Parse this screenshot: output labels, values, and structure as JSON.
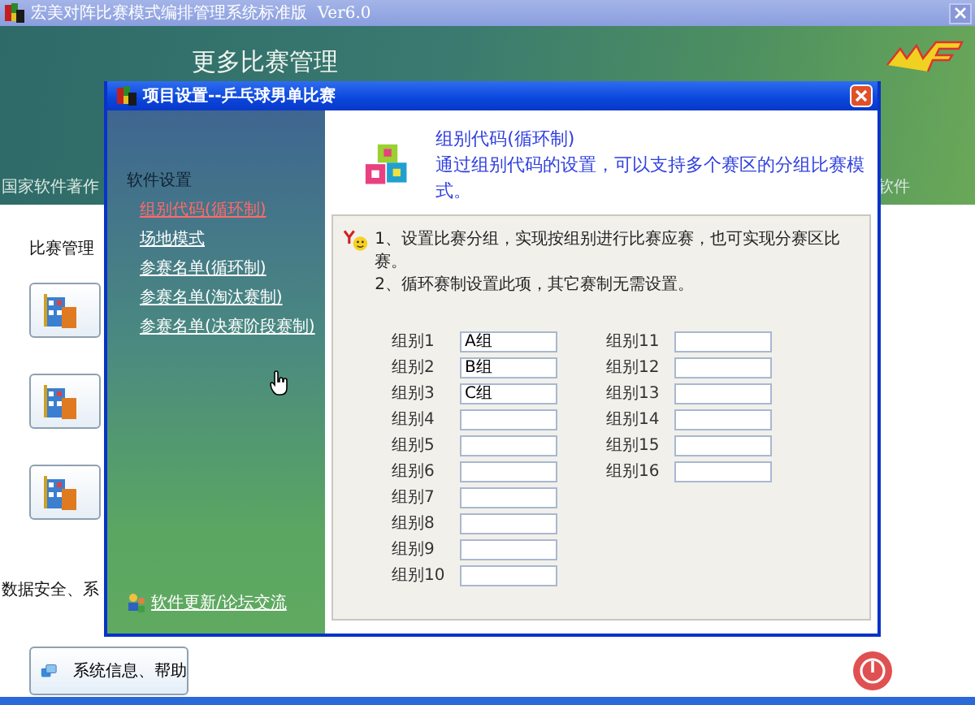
{
  "main_window": {
    "title": "宏美对阵比赛模式编排管理系统标准版  Ver6.0",
    "banner_title": "更多比赛管理",
    "banner_left_text": "国家软件著作",
    "banner_right_text": "软件",
    "section_labels": [
      "比赛管理",
      "数据安全、系"
    ],
    "help_button": {
      "label": "系统信息、帮助"
    }
  },
  "dialog": {
    "title": "项目设置--乒乓球男单比赛",
    "sidebar": {
      "heading": "软件设置",
      "items": [
        {
          "label": "组别代码(循环制)",
          "selected": true
        },
        {
          "label": "场地模式",
          "selected": false
        },
        {
          "label": "参赛名单(循环制)",
          "selected": false
        },
        {
          "label": "参赛名单(淘汰赛制)",
          "selected": false
        },
        {
          "label": "参赛名单(决赛阶段赛制)",
          "selected": false
        }
      ],
      "footer_link": "软件更新/论坛交流"
    },
    "header": {
      "title": "组别代码(循环制)",
      "description": "通过组别代码的设置，可以支持多个赛区的分组比赛模式。"
    },
    "notes": [
      "1、设置比赛分组，实现按组别进行比赛应赛，也可实现分赛区比赛。",
      "2、循环赛制设置此项，其它赛制无需设置。"
    ],
    "fields": [
      {
        "label": "组别1",
        "value": "A组"
      },
      {
        "label": "组别2",
        "value": "B组"
      },
      {
        "label": "组别3",
        "value": "C组"
      },
      {
        "label": "组别4"
      },
      {
        "label": "组别5"
      },
      {
        "label": "组别6"
      },
      {
        "label": "组别7"
      },
      {
        "label": "组别8"
      },
      {
        "label": "组别9"
      },
      {
        "label": "组别10"
      },
      {
        "label": "组别11"
      },
      {
        "label": "组别12"
      },
      {
        "label": "组别13"
      },
      {
        "label": "组别14"
      },
      {
        "label": "组别15"
      },
      {
        "label": "组别16"
      }
    ]
  }
}
